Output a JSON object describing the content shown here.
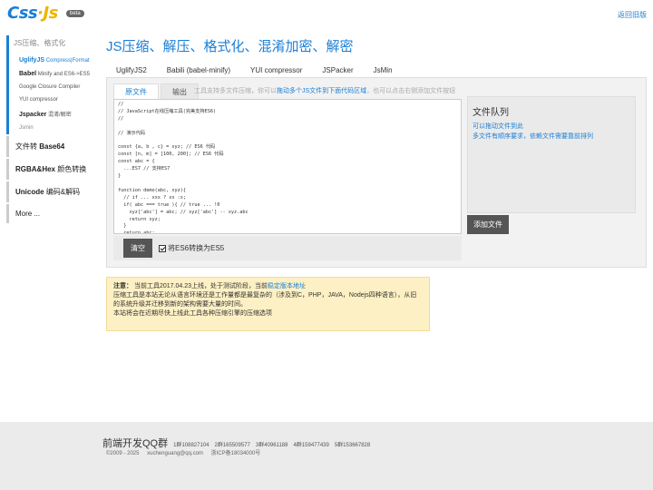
{
  "header": {
    "logo_css": "Css",
    "logo_dot": "·",
    "logo_js": "Js",
    "beta": "beta",
    "back_link": "返回旧版"
  },
  "sidebar": {
    "group_title": "JS压缩、格式化",
    "sub_items": [
      {
        "name": "UglifyJS",
        "desc": "Compress|Format",
        "active": true
      },
      {
        "name": "Babel",
        "desc": "Minify and ES6->ES5",
        "active": false
      },
      {
        "name": "",
        "desc": "Google Closure Compiler",
        "active": false
      },
      {
        "name": "",
        "desc": "YUI compressor",
        "active": false
      },
      {
        "name": "Jspacker",
        "desc": "混淆/解密",
        "active": false
      },
      {
        "name": "",
        "desc": "Jsmin",
        "active": false
      }
    ],
    "items": [
      {
        "bold": "Base64",
        "prefix": "文件转 ",
        "suffix": ""
      },
      {
        "bold": "RGBA&Hex",
        "prefix": "",
        "suffix": " 颜色转换"
      },
      {
        "bold": "Unicode",
        "prefix": "",
        "suffix": " 编码&解码"
      },
      {
        "bold": "",
        "prefix": "More ...",
        "suffix": ""
      }
    ]
  },
  "main": {
    "title": "JS压缩、解压、格式化、混淆加密、解密",
    "tabs": [
      "UglifyJS2",
      "Babili (babel-minify)",
      "YUI compressor",
      "JSPacker",
      "JsMin"
    ],
    "subtabs": [
      "原文件",
      "输出"
    ],
    "hint_pre": "工具支持多文件压缩，你可以",
    "hint_link": "拖动多个JS文件到下面代码区域",
    "hint_post": "，也可以点击右侧添加文件按钮",
    "editor_content": "//\n// JavaScript在线压缩工具(完美支持ES6)\n//\n\n// 演示代码\n\nconst {a, b , c} = xyz; // ES6 代码\nconst [n, m] = [100, 200]; // ES6 代码\nconst abc = {\n  ...ES7 // 支持ES7\n}\n\nfunction demo(abc, xyz){\n  // if ... xxx ? xx :x;\n  if( abc === true ){ // true ... !0\n    xyz['abc'] = abc; // xyz['abc'] -- xyz.abc\n    return xyz;\n  }\n  return abc;",
    "clear_button": "清空",
    "es6_label": "将ES6转换为ES5",
    "es6_checked": true,
    "queue_title": "文件队列",
    "queue_lines": [
      "可以拖动文件到此",
      "多文件有顺序要求，依赖文件需要靠前排列"
    ],
    "add_button": "添加文件"
  },
  "notice": {
    "label": "注意：",
    "line1_pre": "当前工具2017.04.23上线，处于测试阶段，当前",
    "line1_link": "稳定版本地址",
    "line2": "压缩工具是本站无论从语言环境还是工作量都是最复杂的（涉及到C，PHP，JAVA，Nodejs四种语言），从旧的系统升级并迁移到新的架构需要大量的时间。",
    "line3": "本站将会在近期尽快上线此工具各种压缩引擎的压缩选项"
  },
  "footer": {
    "qq_title": "前端开发QQ群",
    "groups": [
      "1群108827104",
      "2群165509577",
      "3群40961188",
      "4群159477439",
      "5群153667828"
    ],
    "copyright": "©2009 - 2025",
    "email": "xuchenguang@qq.com",
    "icp": "浙ICP备18034000号"
  }
}
